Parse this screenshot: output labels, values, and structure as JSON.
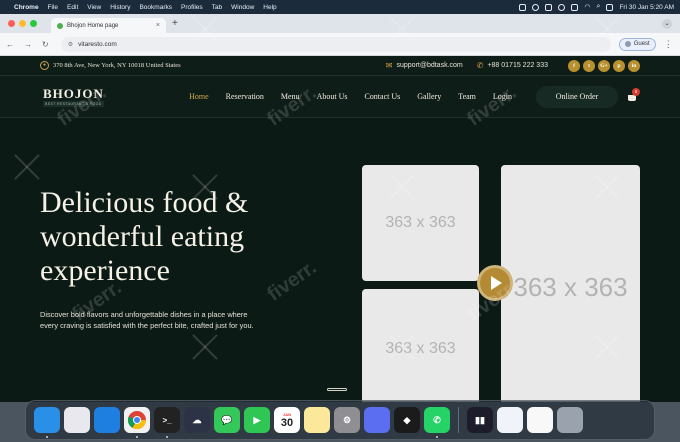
{
  "menubar": {
    "items": [
      "Chrome",
      "File",
      "Edit",
      "View",
      "History",
      "Bookmarks",
      "Profiles",
      "Tab",
      "Window",
      "Help"
    ],
    "clock": "Fri 30 Jan  5:20 AM"
  },
  "browser": {
    "tab_title": "Bhojon Home page",
    "url": "vitaresto.com",
    "profile": "Guest"
  },
  "site": {
    "address": "370 8th Ave, New York, NY 10018 United States",
    "email": "support@bdtask.com",
    "phone": "+88 01715 222 333",
    "social": [
      "f",
      "t",
      "G+",
      "p",
      "in"
    ],
    "logo_name": "BHOJON",
    "logo_tag": "BEST RESTAURANT & FOOD",
    "nav": [
      {
        "label": "Home",
        "active": true
      },
      {
        "label": "Reservation",
        "active": false
      },
      {
        "label": "Menu",
        "active": false
      },
      {
        "label": "About Us",
        "active": false
      },
      {
        "label": "Contact Us",
        "active": false
      },
      {
        "label": "Gallery",
        "active": false
      },
      {
        "label": "Team",
        "active": false
      },
      {
        "label": "Login",
        "active": false
      }
    ],
    "order_button": "Online Order",
    "cart_count": "0"
  },
  "hero": {
    "title_lines": [
      "Delicious food &",
      "wonderful eating",
      "experience"
    ],
    "desc_lines": [
      "Discover bold flavors and unforgettable dishes in a place where",
      "every craving is satisfied with the perfect bite, crafted just for you."
    ],
    "placeholders": [
      "363 x 363",
      "363 x 363",
      "363 x 363"
    ]
  },
  "watermark": "fiverr.",
  "dock": {
    "apps": [
      {
        "name": "finder-icon",
        "color": "#2a8fe6"
      },
      {
        "name": "launchpad-icon",
        "color": "#e8e8ee"
      },
      {
        "name": "safari-icon",
        "color": "#1f7fe0"
      },
      {
        "name": "chrome-icon",
        "color": "#f1f1f1"
      },
      {
        "name": "terminal-icon",
        "color": "#222222"
      },
      {
        "name": "cloud-app-icon",
        "color": "#2d3347"
      },
      {
        "name": "messages-icon",
        "color": "#34c759"
      },
      {
        "name": "facetime-icon",
        "color": "#2fc653"
      },
      {
        "name": "calendar-icon",
        "color": "#ffffff"
      },
      {
        "name": "notes-icon",
        "color": "#fbe89a"
      },
      {
        "name": "system-settings-icon",
        "color": "#8e8e93"
      },
      {
        "name": "simulator-icon",
        "color": "#5b6df0"
      },
      {
        "name": "unity-icon",
        "color": "#1b1b1b"
      },
      {
        "name": "whatsapp-icon",
        "color": "#25d366"
      },
      {
        "name": "activity-monitor-icon",
        "color": "#1c1c2a"
      },
      {
        "name": "tableplus-icon",
        "color": "#f0f4fa"
      },
      {
        "name": "textedit-icon",
        "color": "#f8f8f8"
      },
      {
        "name": "trash-icon",
        "color": "#9aa3ad"
      }
    ],
    "calendar_day": "30",
    "calendar_month": "JAN"
  }
}
